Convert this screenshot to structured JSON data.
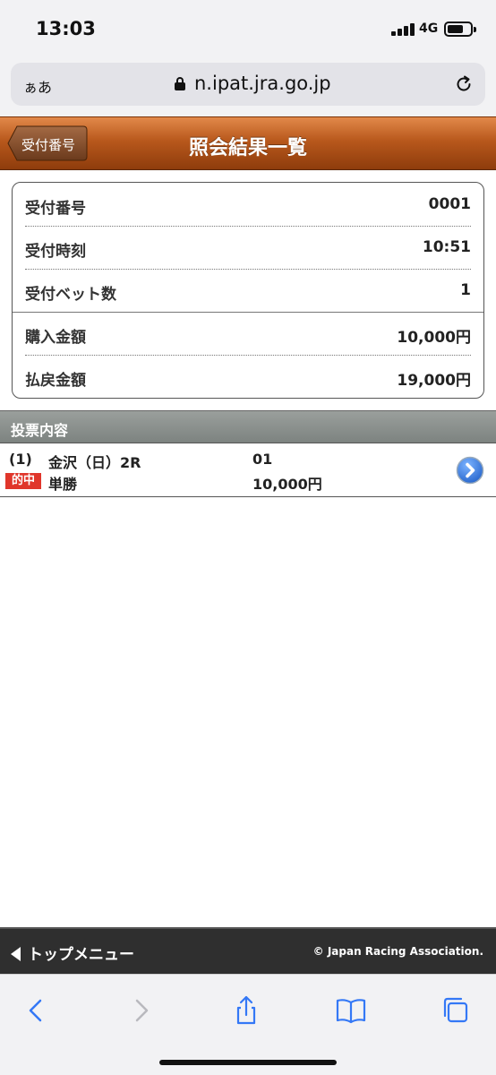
{
  "status_bar": {
    "time": "13:03",
    "network": "4G"
  },
  "browser": {
    "text_size_label": "ぁあ",
    "url": "n.ipat.jra.go.jp"
  },
  "header": {
    "back_label": "受付番号",
    "title": "照会結果一覧"
  },
  "info": {
    "receipt_number_label": "受付番号",
    "receipt_number": "0001",
    "receipt_time_label": "受付時刻",
    "receipt_time": "10:51",
    "bet_count_label": "受付ベット数",
    "bet_count": "1",
    "purchase_label": "購入金額",
    "purchase_amount": "10,000円",
    "payout_label": "払戻金額",
    "payout_amount": "19,000円"
  },
  "votes": {
    "section_title": "投票内容",
    "items": [
      {
        "number": "(1)",
        "race": "金沢（日）2R",
        "horse": "01",
        "hit_badge": "的中",
        "bet_type": "単勝",
        "amount": "10,000円"
      }
    ]
  },
  "footer": {
    "top_menu": "トップメニュー",
    "copyright": "© Japan Racing Association."
  },
  "colors": {
    "header_orange": "#b8581c",
    "hit_red": "#e0362b",
    "safari_blue": "#3478f6"
  }
}
